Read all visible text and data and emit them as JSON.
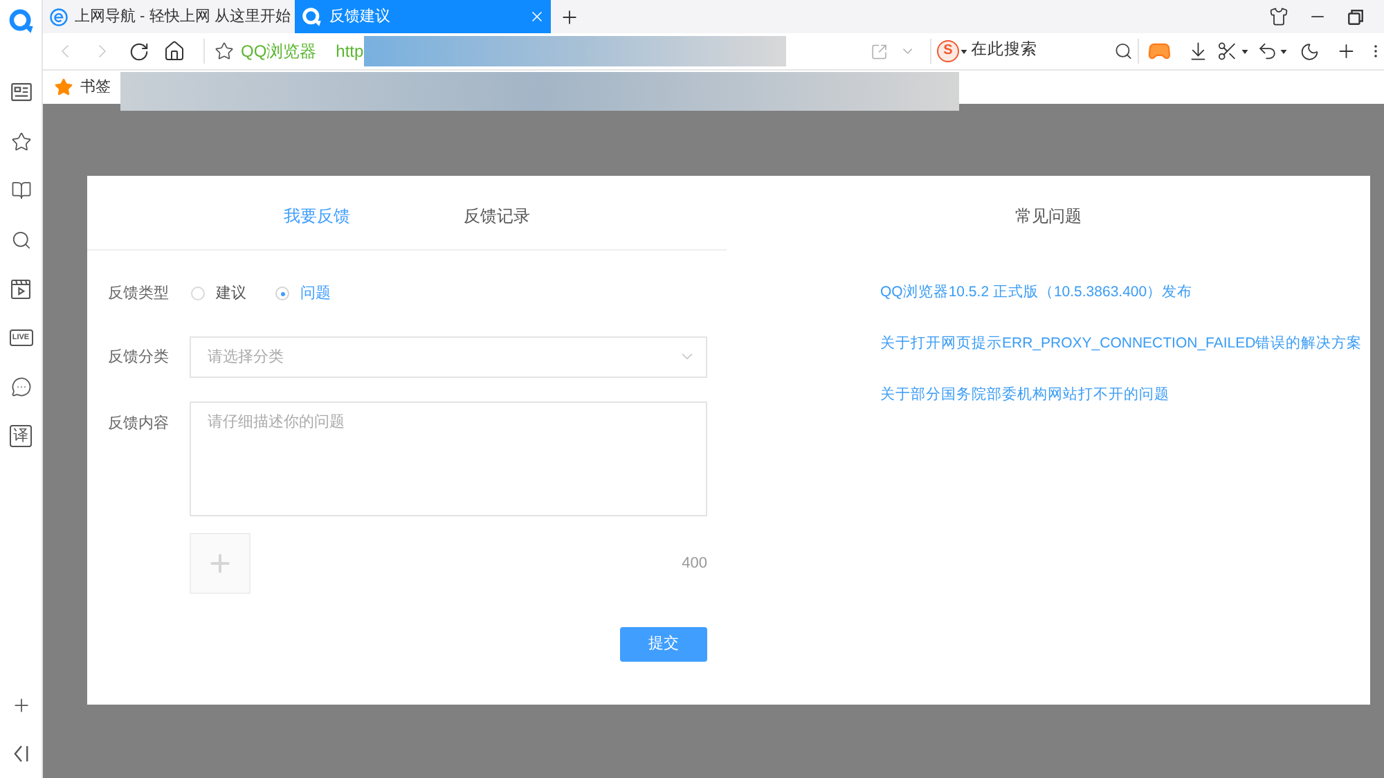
{
  "browser": {
    "tabs": [
      {
        "kind": "web",
        "title": "上网导航 - 轻快上网 从这里开始",
        "selected": false
      },
      {
        "kind": "internal",
        "title": "反馈建议",
        "selected": true
      }
    ],
    "nav": {
      "back_disabled": true,
      "forward_disabled": true
    },
    "address_bar": {
      "site_name": "QQ浏览器",
      "url": "http"
    },
    "search": {
      "engine_badge": "S",
      "placeholder": "在此搜索"
    },
    "bookmarks_bar": {
      "label": "书签"
    }
  },
  "sidebar": {
    "live_label": "LIVE",
    "translate_label": "译"
  },
  "feedback": {
    "tabs": [
      {
        "label": "我要反馈",
        "selected": true
      },
      {
        "label": "反馈记录",
        "selected": false
      }
    ],
    "type": {
      "label": "反馈类型",
      "options": [
        {
          "label": "建议",
          "selected": false
        },
        {
          "label": "问题",
          "selected": true
        }
      ]
    },
    "category": {
      "label": "反馈分类",
      "placeholder": "请选择分类"
    },
    "content": {
      "label": "反馈内容",
      "placeholder": "请仔细描述你的问题",
      "counter": "400"
    },
    "submit": "提交"
  },
  "faq": {
    "title": "常见问题",
    "links": [
      "QQ浏览器10.5.2 正式版（10.5.3863.400）发布",
      "关于打开网页提示ERR_PROXY_CONNECTION_FAILED错误的解决方案",
      "关于部分国务院部委机构网站打不开的问题"
    ]
  }
}
